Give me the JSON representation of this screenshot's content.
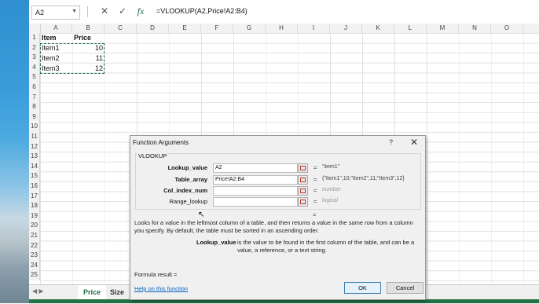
{
  "formula_bar": {
    "name_box": "A2",
    "cancel_glyph": "✕",
    "enter_glyph": "✓",
    "function_glyph": "fx",
    "formula": "=VLOOKUP(A2,Price!A2:B4)"
  },
  "grid": {
    "columns": [
      "A",
      "B",
      "C",
      "D",
      "E",
      "F",
      "G",
      "H",
      "I",
      "J",
      "K",
      "L",
      "M",
      "N",
      "O"
    ],
    "rows": [
      "1",
      "2",
      "3",
      "4",
      "5",
      "6",
      "7",
      "8",
      "9",
      "10",
      "11",
      "12",
      "13",
      "14",
      "15",
      "16",
      "17",
      "18",
      "19",
      "20",
      "21",
      "22",
      "23",
      "24",
      "25"
    ],
    "cells": {
      "A1": "Item",
      "B1": "Price",
      "A2": "Item1",
      "B2": "10",
      "A3": "Item2",
      "B3": "11",
      "A4": "Item3",
      "B4": "12"
    }
  },
  "sheet_tabs": {
    "tabs": [
      "Price",
      "Size"
    ],
    "active": "Price"
  },
  "dialog": {
    "title": "Function Arguments",
    "help_glyph": "?",
    "close_glyph": "✕",
    "function_name": "VLOOKUP",
    "arguments": [
      {
        "label": "Lookup_value",
        "value": "A2",
        "result": "\"item1\"",
        "bold": true
      },
      {
        "label": "Table_array",
        "value": "Price!A2:B4",
        "result": "{\"Item1\",10;\"Item2\",11;\"Item3\",12}",
        "bold": true
      },
      {
        "label": "Col_index_num",
        "value": "",
        "result": "number",
        "bold": true
      },
      {
        "label": "Range_lookup",
        "value": "",
        "result": "logical",
        "bold": false
      }
    ],
    "equals": "=",
    "description": "Looks for a value in the leftmost column of a table, and then returns a value in the same row from a column you specify. By default, the table must be sorted in an ascending order.",
    "arg_description_name": "Lookup_value",
    "arg_description_text": "is the value to be found in the first column of the table, and can be a value, a reference, or a text string.",
    "formula_result": "Formula result =",
    "help_link": "Help on this function",
    "ok_label": "OK",
    "cancel_label": "Cancel"
  },
  "colors": {
    "excel_green": "#217346",
    "link_blue": "#0563c1",
    "selection_border": "#1e7145"
  }
}
